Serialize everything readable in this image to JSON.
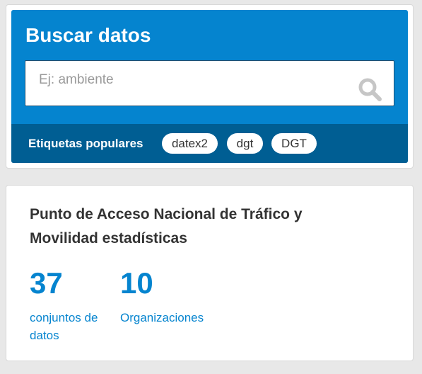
{
  "search": {
    "heading": "Buscar datos",
    "placeholder": "Ej: ambiente",
    "value": "",
    "tags_label": "Etiquetas populares",
    "tags": [
      "datex2",
      "dgt",
      "DGT"
    ]
  },
  "stats": {
    "title": "Punto de Acceso Nacional de Tráfico y Movilidad estadísticas",
    "items": [
      {
        "number": "37",
        "label": "conjuntos de datos"
      },
      {
        "number": "10",
        "label": "Organizaciones"
      }
    ]
  },
  "colors": {
    "primary": "#0584cf",
    "primary_dark": "#005e93",
    "text": "#333333"
  }
}
